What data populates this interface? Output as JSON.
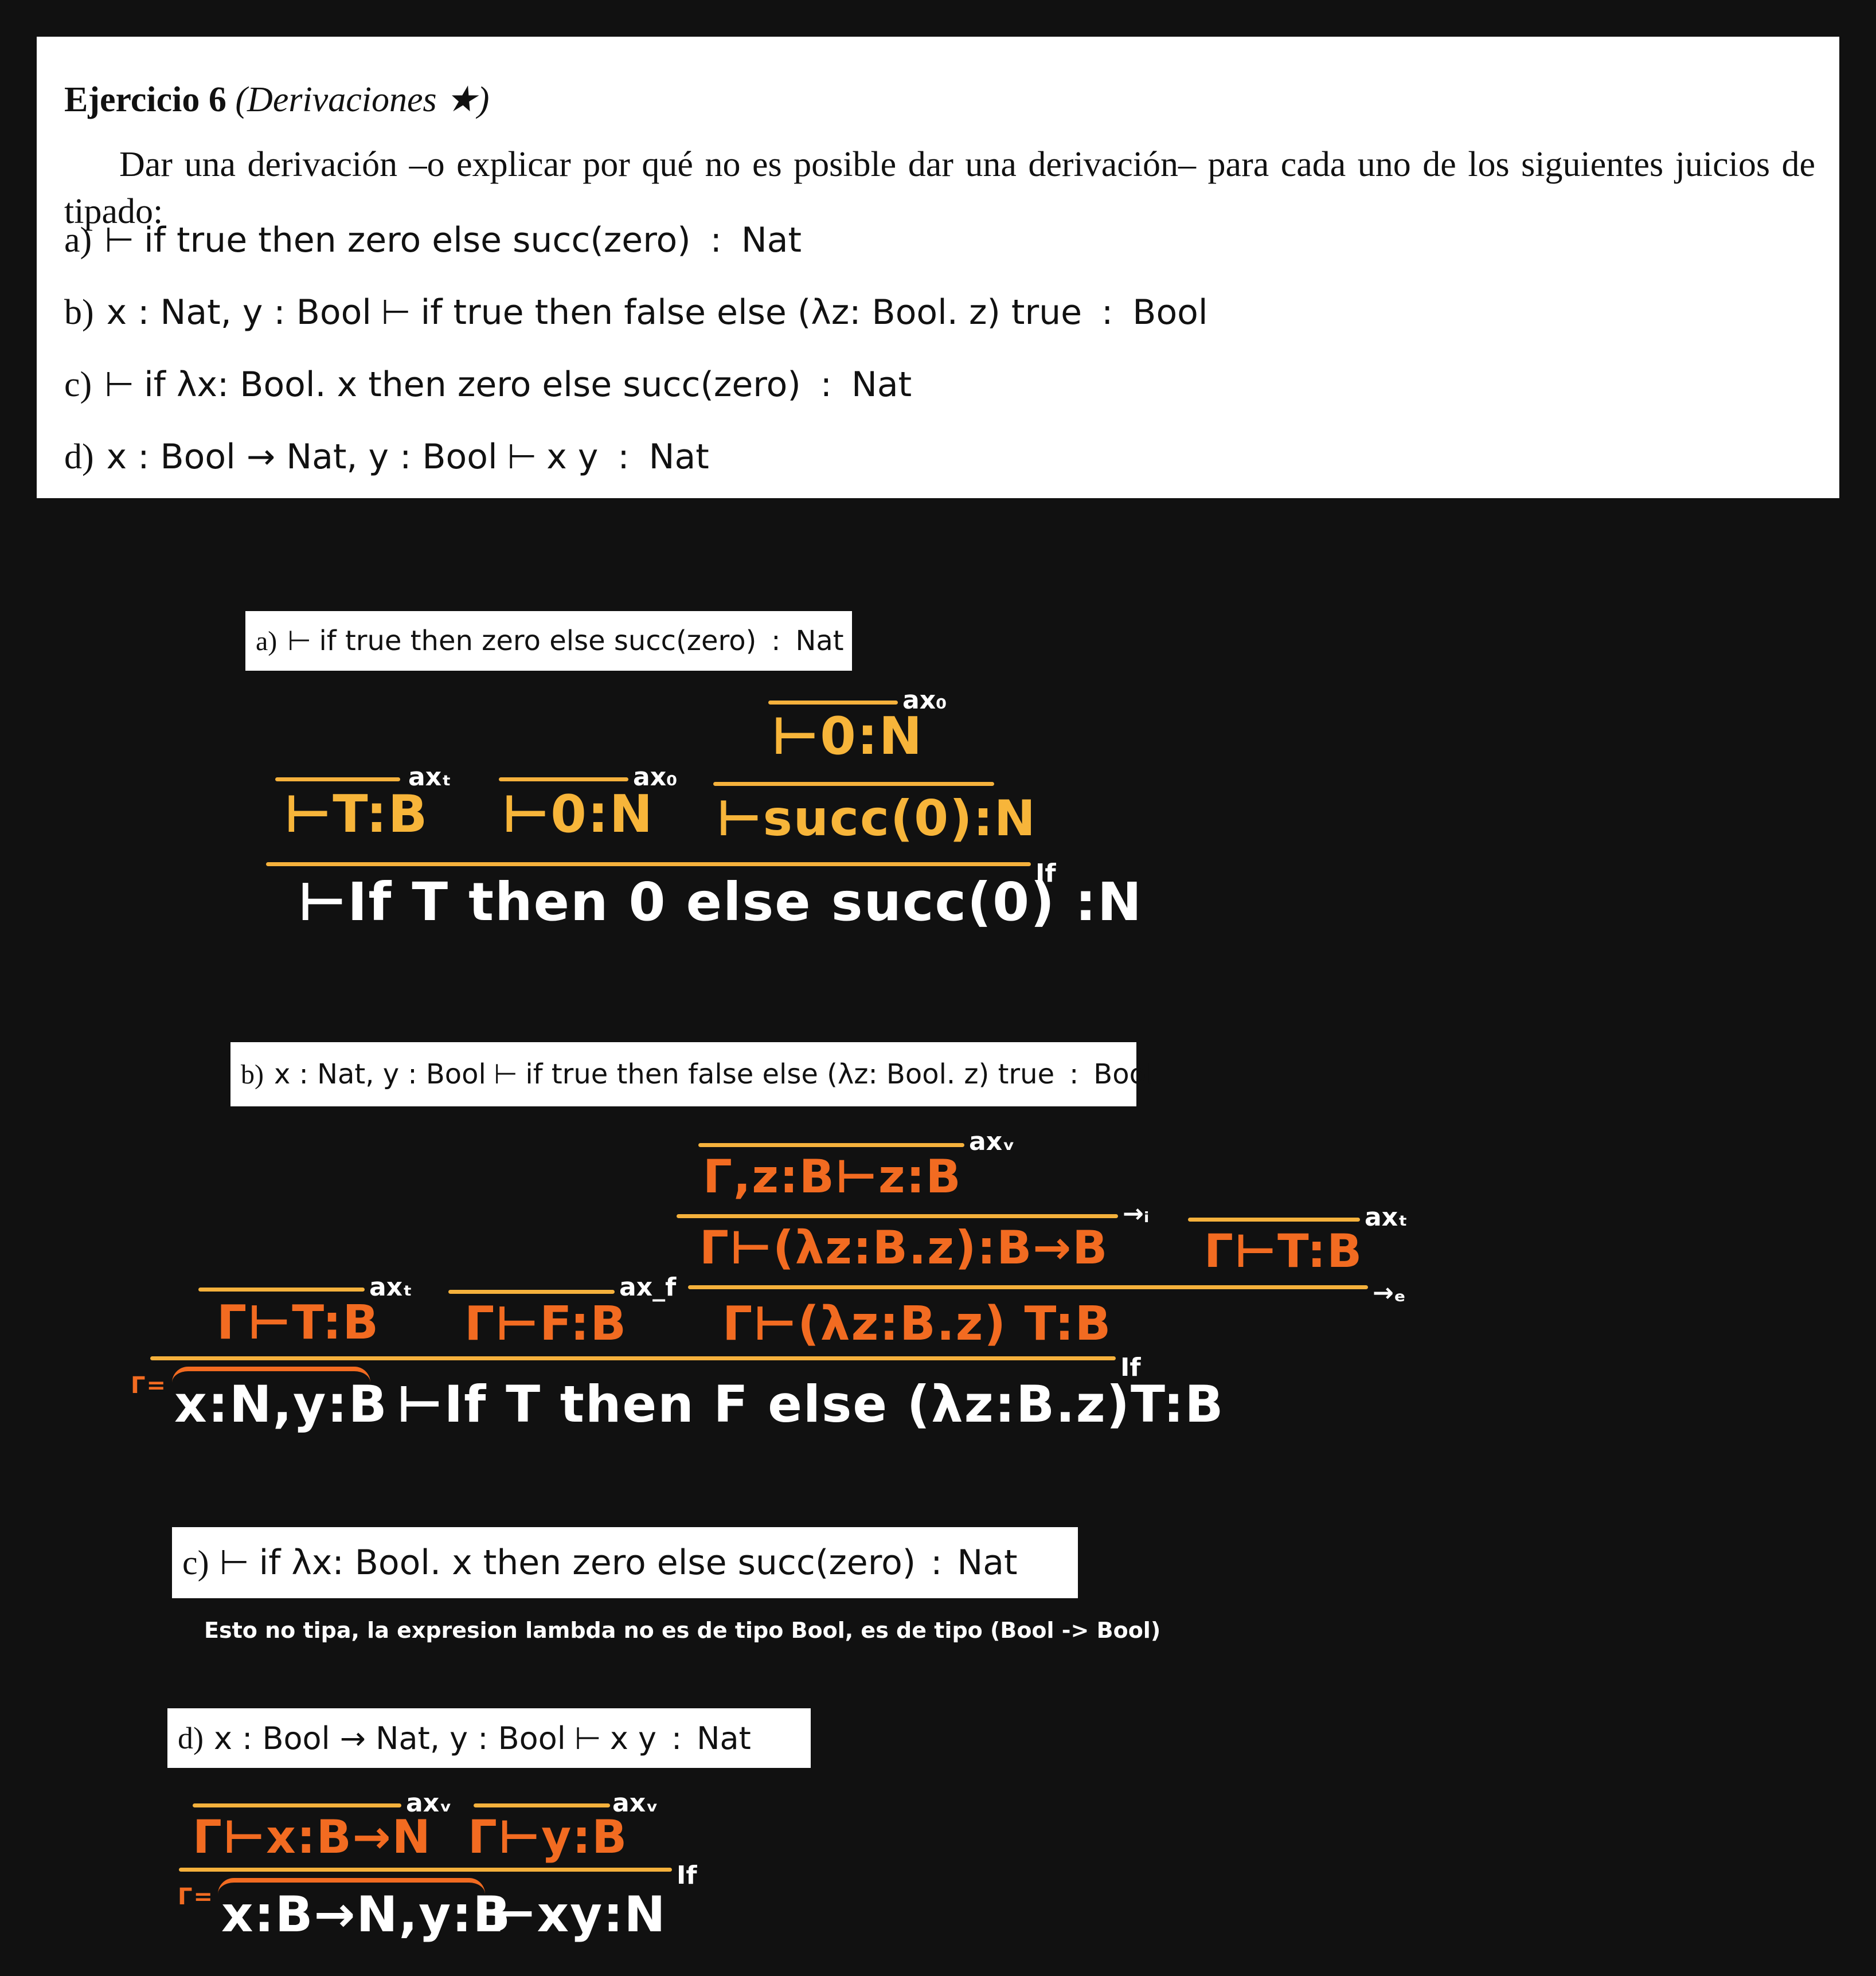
{
  "exercise": {
    "title_bold": "Ejercicio 6",
    "title_italic": "(Derivaciones ★)",
    "intro": "Dar una derivación –o explicar por qué no es posible dar una derivación– para cada uno de los siguientes juicios de tipado:",
    "items": [
      {
        "label": "a)",
        "ctx": "",
        "turnstile": "⊢",
        "term": "if true then zero else succ(zero)",
        "colon": ":",
        "type": "Nat"
      },
      {
        "label": "b)",
        "ctx": "x : Nat, y : Bool",
        "turnstile": "⊢",
        "term": "if true then false else (λz: Bool. z) true",
        "colon": ":",
        "type": "Bool"
      },
      {
        "label": "c)",
        "ctx": "",
        "turnstile": "⊢",
        "term": "if λx: Bool. x then zero else succ(zero)",
        "colon": ":",
        "type": "Nat"
      },
      {
        "label": "d)",
        "ctx": "x : Bool → Nat, y : Bool",
        "turnstile": "⊢",
        "term": "x y",
        "colon": ":",
        "type": "Nat"
      }
    ]
  },
  "derivation_a": {
    "top": "⊢0:N",
    "top_rule": "ax₀",
    "p1": "⊢T:B",
    "p1_rule": "axₜ",
    "p2": "⊢0:N",
    "p2_rule": "ax₀",
    "p3": "⊢succ(0):N",
    "conclusion": "⊢If T then 0 else succ(0) :N",
    "conclusion_rule": "If"
  },
  "derivation_b": {
    "top": "Γ,z:B⊢z:B",
    "top_rule": "axᵥ",
    "abs": "Γ⊢(λz:B.z):B→B",
    "abs_rule": "→ᵢ",
    "arg": "Γ⊢T:B",
    "arg_rule": "axₜ",
    "app": "Γ⊢(λz:B.z) T:B",
    "app_rule": "→ₑ",
    "p1": "Γ⊢T:B",
    "p1_rule": "axₜ",
    "p2": "Γ⊢F:B",
    "p2_rule": "ax_f",
    "gamma_def": "Γ=",
    "ctx": "x:N,y:B",
    "conclusion": "⊢If T then F else (λz:B.z)T:B",
    "conclusion_rule": "If"
  },
  "note_c": "Esto no tipa, la expresion lambda no es de tipo Bool, es de tipo (Bool -> Bool)",
  "derivation_d": {
    "p1": "Γ⊢x:B→N",
    "p1_rule": "axᵥ",
    "p2": "Γ⊢y:B",
    "p2_rule": "axᵥ",
    "gamma_def": "Γ=",
    "ctx": "x:B→N,y:B",
    "conclusion": "⊢xy:N",
    "conclusion_rule": "If"
  }
}
